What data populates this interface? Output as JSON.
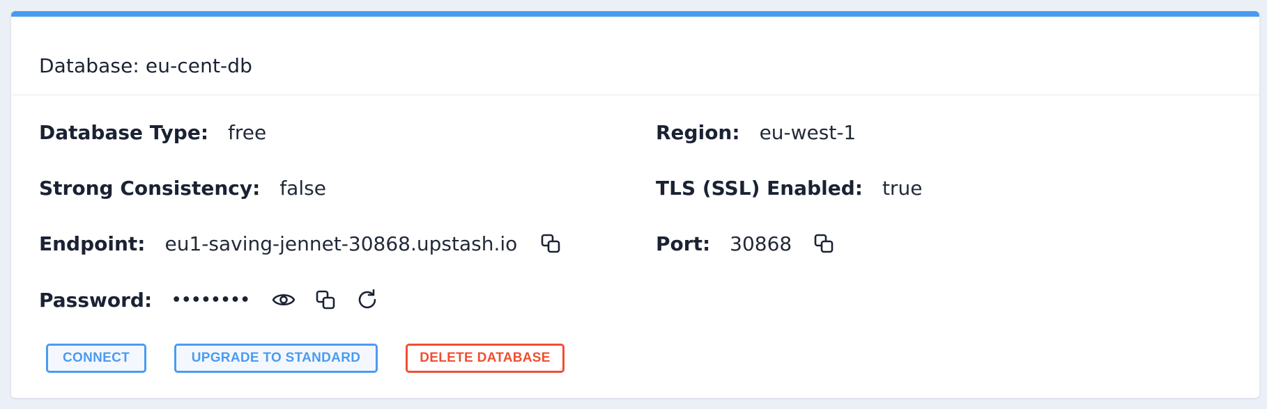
{
  "card": {
    "title": "Database: eu-cent-db",
    "accent_color": "#4a9bf0"
  },
  "details": {
    "database_type": {
      "label": "Database Type:",
      "value": "free"
    },
    "region": {
      "label": "Region:",
      "value": "eu-west-1"
    },
    "strong_consistency": {
      "label": "Strong Consistency:",
      "value": "false"
    },
    "tls": {
      "label": "TLS (SSL) Enabled:",
      "value": "true"
    },
    "endpoint": {
      "label": "Endpoint:",
      "value": "eu1-saving-jennet-30868.upstash.io",
      "icon": "copy-icon"
    },
    "port": {
      "label": "Port:",
      "value": "30868",
      "icon": "copy-icon"
    },
    "password": {
      "label": "Password:",
      "value": "••••••••",
      "icons": [
        "eye-icon",
        "copy-icon",
        "refresh-icon"
      ]
    }
  },
  "actions": {
    "connect": "CONNECT",
    "upgrade": "UPGRADE TO STANDARD",
    "delete": "DELETE DATABASE",
    "primary_color": "#4a9bf0",
    "danger_color": "#ef4f32"
  }
}
